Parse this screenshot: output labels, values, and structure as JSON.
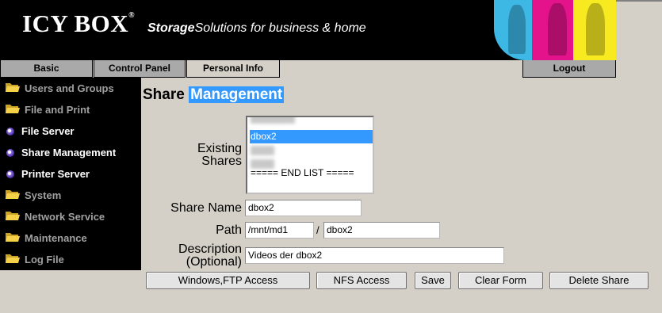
{
  "header": {
    "logo": "ICY BOX",
    "logo_mark": "®",
    "tagline_bold": "Storage",
    "tagline_rest": "Solutions for business & home"
  },
  "tabs": {
    "basic": "Basic",
    "control_panel": "Control Panel",
    "personal_info": "Personal Info",
    "logout": "Logout"
  },
  "sidebar": {
    "items": [
      {
        "label": "Users and Groups",
        "icon": "folder-icon"
      },
      {
        "label": "File and Print",
        "icon": "folder-icon"
      },
      {
        "label": "File Server",
        "icon": "bullet-icon"
      },
      {
        "label": "Share Management",
        "icon": "bullet-icon"
      },
      {
        "label": "Printer Server",
        "icon": "bullet-icon"
      },
      {
        "label": "System",
        "icon": "folder-icon"
      },
      {
        "label": "Network Service",
        "icon": "folder-icon"
      },
      {
        "label": "Maintenance",
        "icon": "folder-icon"
      },
      {
        "label": "Log File",
        "icon": "folder-icon"
      }
    ]
  },
  "main": {
    "title_part1": "Share",
    "title_part2": "Management",
    "existing_shares_label_1": "Existing",
    "existing_shares_label_2": "Shares",
    "shares_list": {
      "items": [
        "",
        "dbox2",
        "",
        "",
        "===== END LIST ====="
      ],
      "selected": "dbox2"
    },
    "share_name_label": "Share Name",
    "share_name_value": "dbox2",
    "path_label": "Path",
    "path_base_value": "/mnt/md1",
    "path_separator": "/",
    "path_dir_value": "dbox2",
    "description_label_1": "Description",
    "description_label_2": "(Optional)",
    "description_value": "Videos der dbox2"
  },
  "buttons": {
    "windows_ftp": "Windows,FTP Access",
    "nfs": "NFS Access",
    "save": "Save",
    "clear": "Clear Form",
    "delete": "Delete Share"
  },
  "colors": {
    "banner": "#000000",
    "page_bg": "#d4d0c8",
    "highlight": "#3399ff",
    "folder": "#f5d14a"
  }
}
